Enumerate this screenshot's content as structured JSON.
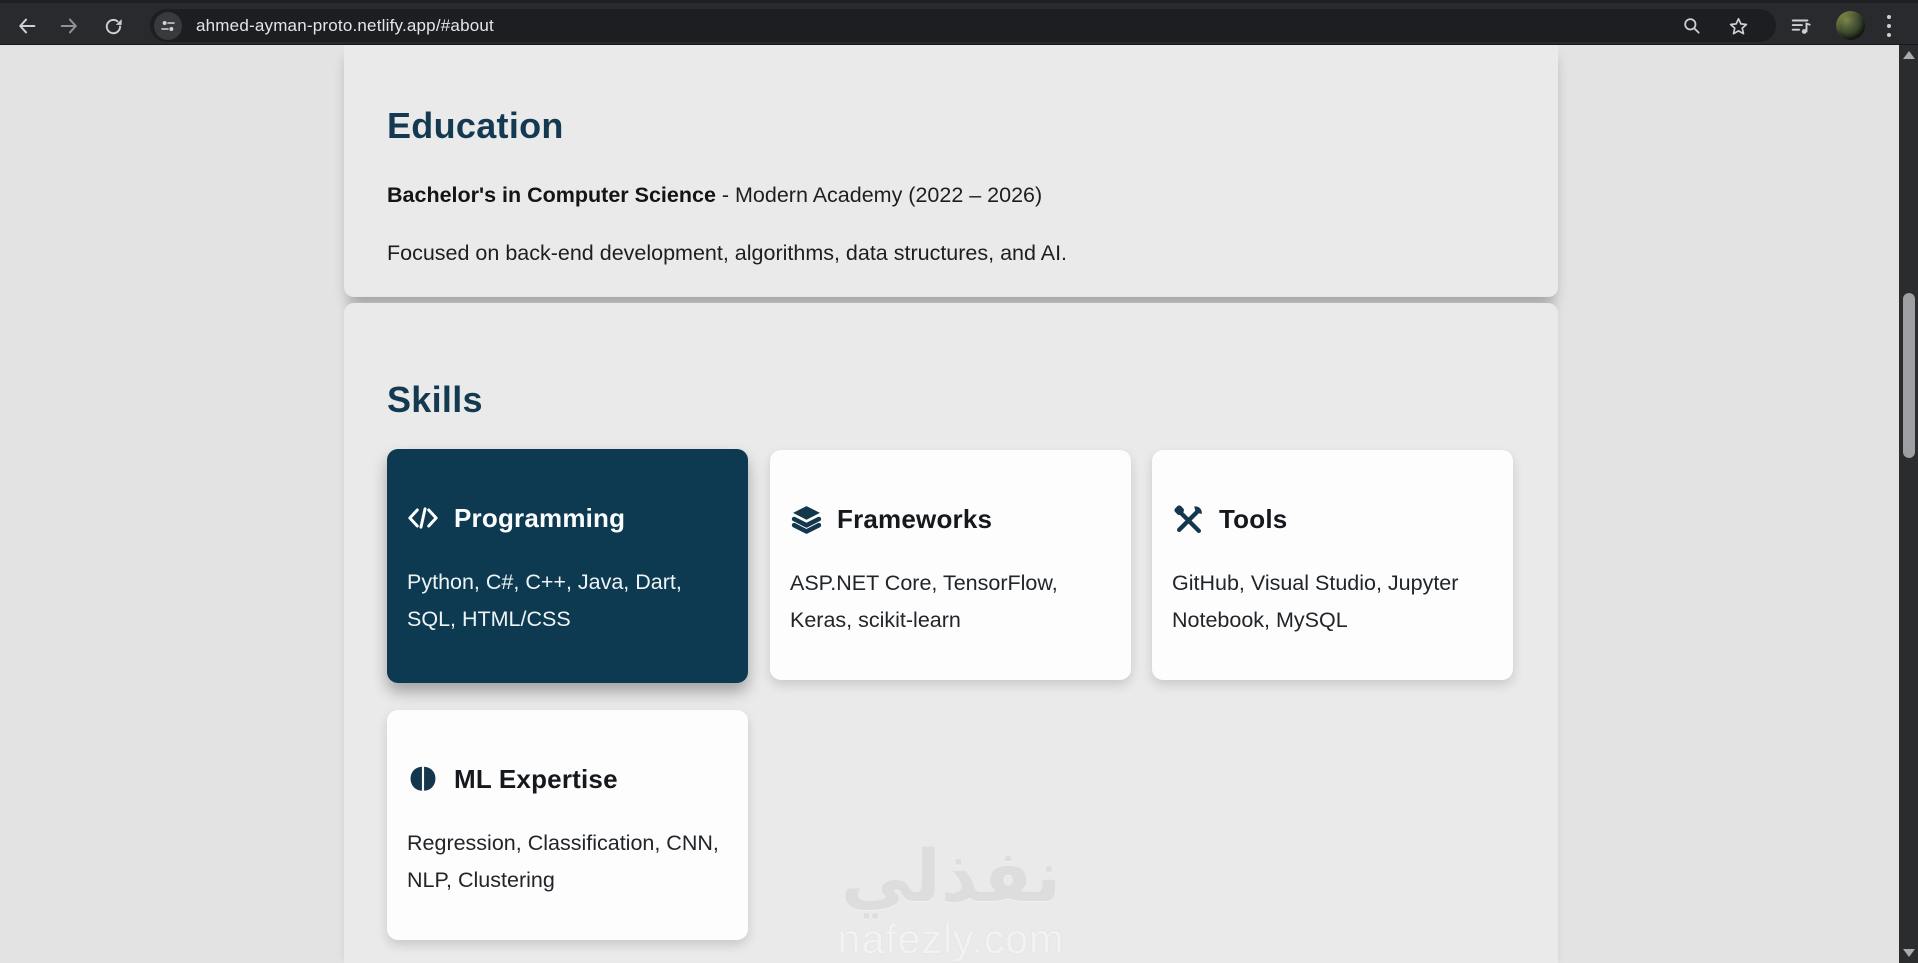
{
  "browser": {
    "url": "ahmed-ayman-proto.netlify.app/#about",
    "icons": [
      "back-arrow-icon",
      "forward-arrow-icon",
      "reload-icon",
      "site-settings-tune-icon",
      "zoom-search-icon",
      "bookmark-star-icon",
      "media-controls-icon",
      "profile-avatar",
      "menu-dots-icon"
    ],
    "colors": {
      "toolbar": "#292a2d",
      "omnibox": "#1d1e21",
      "icon": "#c8c9cb"
    }
  },
  "page": {
    "education": {
      "heading": "Education",
      "degree": "Bachelor's in Computer Science",
      "degree_suffix": " - Modern Academy (2022 – 2026)",
      "description": "Focused on back-end development, algorithms, data structures, and AI."
    },
    "skills": {
      "heading": "Skills",
      "cards": [
        {
          "icon": "code-icon",
          "title": "Programming",
          "items": "Python, C#, C++, Java, Dart, SQL, HTML/CSS",
          "active": true
        },
        {
          "icon": "layers-icon",
          "title": "Frameworks",
          "items": "ASP.NET Core, TensorFlow, Keras, scikit-learn",
          "active": false
        },
        {
          "icon": "tools-icon",
          "title": "Tools",
          "items": "GitHub, Visual Studio, Jupyter Notebook, MySQL",
          "active": false
        },
        {
          "icon": "brain-icon",
          "title": "ML Expertise",
          "items": "Regression, Classification, CNN, NLP, Clustering",
          "active": false
        }
      ]
    },
    "watermark": {
      "arabic": "نفذلي",
      "latin": "nafezly.com"
    },
    "colors": {
      "accent_dark_teal": "#0d3a50",
      "heading": "#143a52",
      "section_bg": "#eaeaea",
      "page_bg": "#e3e3e3",
      "card_bg": "#fdfdfd"
    }
  }
}
